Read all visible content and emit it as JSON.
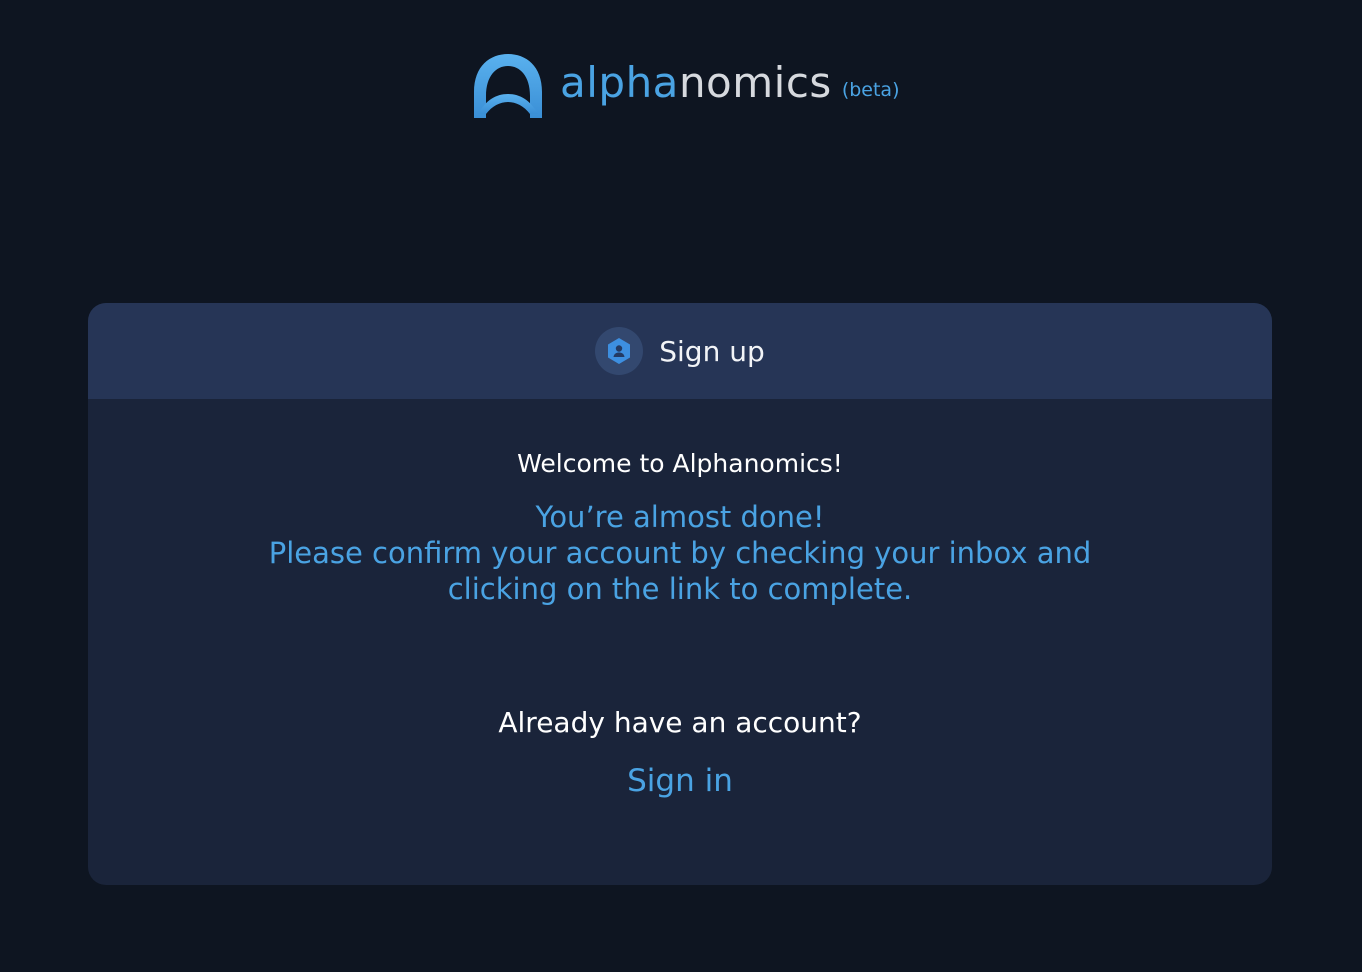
{
  "logo": {
    "word_part1": "alpha",
    "word_part2": "nomics",
    "badge": "(beta)",
    "icon": "alphanomics-logo-icon"
  },
  "card": {
    "header_title": "Sign up",
    "header_icon": "user-shield-icon",
    "welcome": "Welcome to Alphanomics!",
    "message_lines": [
      "You’re almost done!",
      "Please confirm your account by checking your inbox and",
      "clicking on the link to complete."
    ],
    "already_text": "Already have an account?",
    "signin_label": "Sign in"
  },
  "colors": {
    "background": "#0e1521",
    "card": "#1a243a",
    "card_header": "#263556",
    "accent": "#4aa3e3"
  }
}
